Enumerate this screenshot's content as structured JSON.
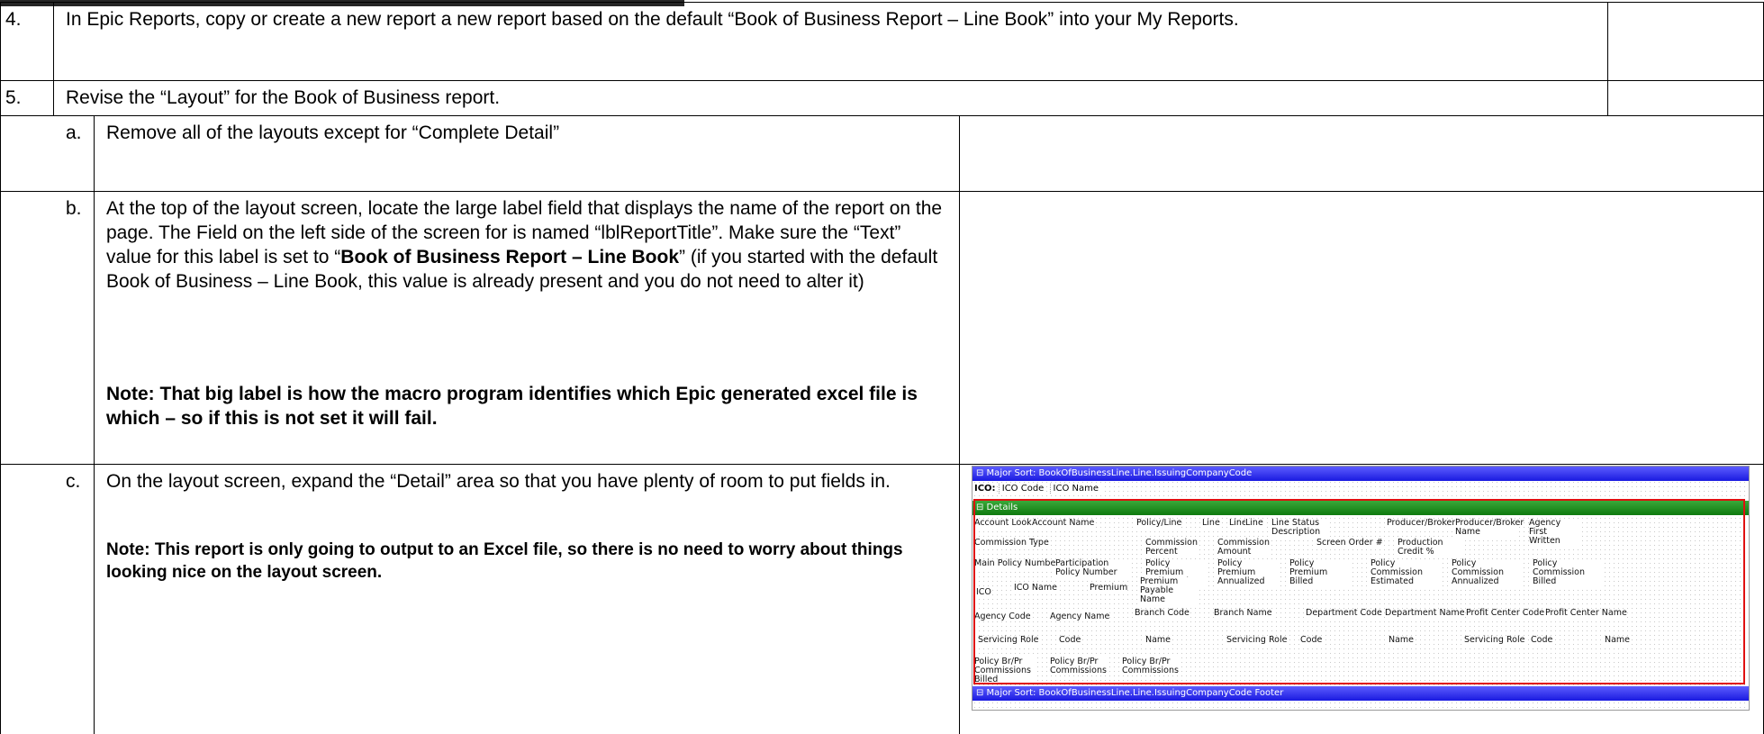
{
  "rows": [
    {
      "num": "4.",
      "text": "In Epic Reports, copy or create a new report a new report based on the default “Book of Business Report – Line Book” into your My Reports."
    },
    {
      "num": "5.",
      "text": "Revise the “Layout” for the Book of Business report."
    }
  ],
  "subrows": {
    "a": {
      "letter": "a.",
      "text": "Remove all of the layouts except for “Complete Detail”"
    },
    "b": {
      "letter": "b.",
      "text_part1": "At the top of the layout screen, locate the large label field that displays the name of the report on the page.  The Field on the left side of the screen for is named “lblReportTitle”.  Make sure the “Text” value for this label is set to “",
      "text_bold": "Book of Business Report – Line Book",
      "text_part2": "” (if you started with the default Book of Business – Line Book, this value is already present and you do not need to alter it)",
      "note": "Note: That big label is how the macro program identifies which Epic generated excel file is which – so if this is not set it will fail."
    },
    "c": {
      "letter": "c.",
      "text": "On the layout screen, expand the “Detail” area so that you have plenty of room to put fields in.",
      "note": "Note: This report is only going to output to an Excel file, so there is no need to worry about things looking nice on the layout screen."
    }
  },
  "screenshot": {
    "header_band": "⊟ Major Sort: BookOfBusinessLine.Line.IssuingCompanyCode",
    "ico_label": "ICO:",
    "ico_code": "ICO Code",
    "ico_name": "ICO Name",
    "details_band": "⊟ Details",
    "footer_band": "⊟ Major Sort: BookOfBusinessLine.Line.IssuingCompanyCode Footer",
    "fields": {
      "r1": [
        "Account Lookup",
        "Account Name",
        "Policy/Line",
        "Line",
        "Line",
        "Line",
        "Line Status Description",
        "Producer/Broker",
        "Producer/Broker Name",
        "Agency First Written"
      ],
      "r2": [
        "Commission Type",
        "Commission Percent",
        "Commission Amount",
        "Screen Order #",
        "Production Credit %"
      ],
      "r3": [
        "Main Policy Number",
        "Participation Policy Number",
        "Policy Premium Estimated",
        "Policy Premium Annualized",
        "Policy Premium Billed",
        "Policy Commission Estimated",
        "Policy Commission Annualized",
        "Policy Commission Billed"
      ],
      "r4": [
        "ICO",
        "ICO Name",
        "Premium",
        "Premium Payable Name"
      ],
      "r5": [
        "Agency Code",
        "Agency Name",
        "Branch Code",
        "Branch Name",
        "Department Code",
        "Department Name",
        "Profit Center Code",
        "Profit Center Name"
      ],
      "r6": [
        "Servicing Role",
        "Code",
        "Name",
        "Servicing Role",
        "Code",
        "Name",
        "Servicing Role",
        "Code",
        "Name"
      ],
      "r7": [
        "Policy Br/Pr Commissions Billed",
        "Policy Br/Pr Commissions",
        "Policy Br/Pr Commissions"
      ]
    }
  }
}
